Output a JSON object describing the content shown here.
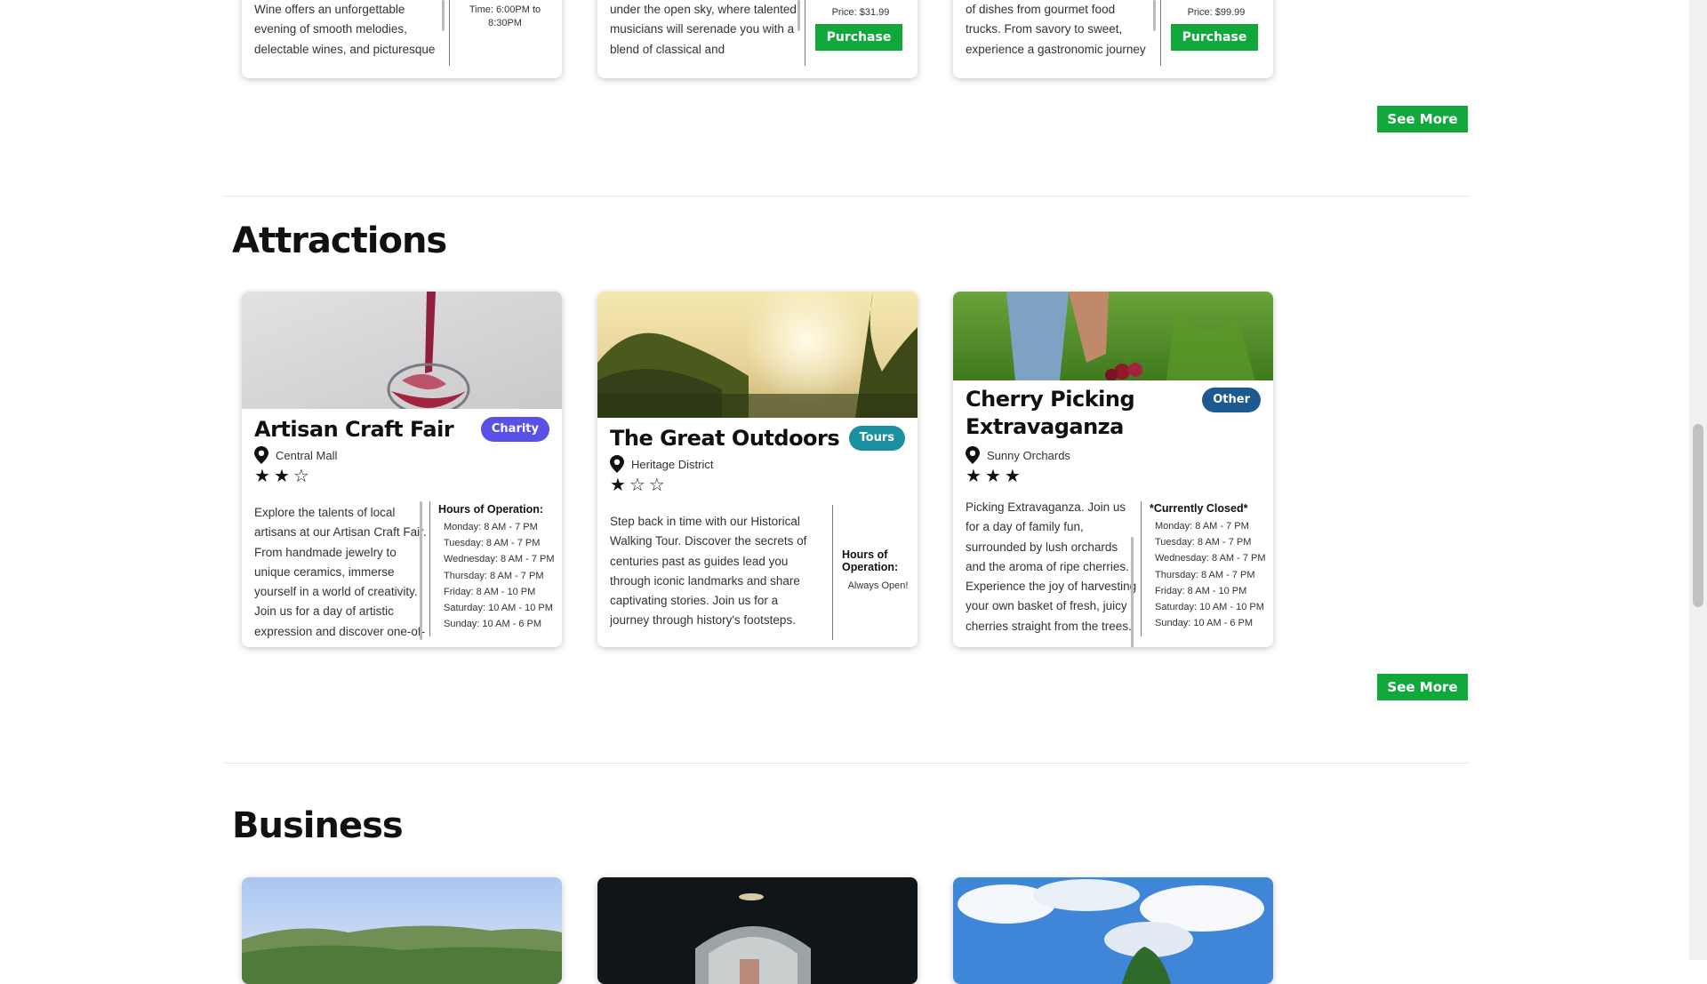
{
  "colors": {
    "accent_green": "#10a83b",
    "badge_charity": "#5b50e6",
    "badge_tours": "#1a8fa0",
    "badge_other": "#1d5a8f"
  },
  "top_cards": [
    {
      "description": "Wine offers an unforgettable evening of smooth melodies, delectable wines, and picturesque views. Let the rhythm of jazz serenade you under",
      "time": "Time: 6:00PM to 8:30PM"
    },
    {
      "description": "under the open sky, where talented musicians will serenade you with a blend of classical and contemporary tunes. Bring a blanket, relax, and let",
      "price": "Price: $31.99",
      "purchase_label": "Purchase"
    },
    {
      "description": "of dishes from gourmet food trucks. From savory to sweet, experience a gastronomic journey in a lively outdoor setting. Bring your appetite",
      "price": "Price: $99.99",
      "purchase_label": "Purchase"
    }
  ],
  "see_more_label": "See More",
  "attractions": {
    "title": "Attractions",
    "cards": [
      {
        "title": "Artisan Craft Fair",
        "badge": "Charity",
        "location": "Central Mall",
        "rating": 2,
        "description": "Explore the talents of local artisans at our Artisan Craft Fair. From handmade jewelry to unique ceramics, immerse yourself in a world of creativity. Join us for a day of artistic expression and discover one-of-a-kind treasures.",
        "hours_title": "Hours of Operation:",
        "hours": [
          "Monday: 8 AM - 7 PM",
          "Tuesday: 8 AM - 7 PM",
          "Wednesday: 8 AM - 7 PM",
          "Thursday: 8 AM - 7 PM",
          "Friday: 8 AM - 10 PM",
          "Saturday: 10 AM - 10 PM",
          "Sunday: 10 AM - 6 PM"
        ]
      },
      {
        "title": "The Great Outdoors",
        "badge": "Tours",
        "location": "Heritage District",
        "rating": 1,
        "description": "Step back in time with our Historical Walking Tour. Discover the secrets of centuries past as guides lead you through iconic landmarks and share captivating stories. Join us for a journey through history's footsteps.",
        "hours_title": "Hours of Operation:",
        "hours_note": "Always Open!"
      },
      {
        "title": "Cherry Picking Extravaganza",
        "badge": "Other",
        "location": "Sunny Orchards",
        "rating": 3,
        "description": "Picking Extravaganza. Join us for a day of family fun, surrounded by lush orchards and the aroma of ripe cherries. Experience the joy of harvesting your own basket of fresh, juicy cherries straight from the trees.",
        "hours_title": "*Currently Closed*",
        "hours": [
          "Monday: 8 AM - 7 PM",
          "Tuesday: 8 AM - 7 PM",
          "Wednesday: 8 AM - 7 PM",
          "Thursday: 8 AM - 7 PM",
          "Friday: 8 AM - 10 PM",
          "Saturday: 10 AM - 10 PM",
          "Sunday: 10 AM - 6 PM"
        ]
      }
    ]
  },
  "business": {
    "title": "Business"
  }
}
